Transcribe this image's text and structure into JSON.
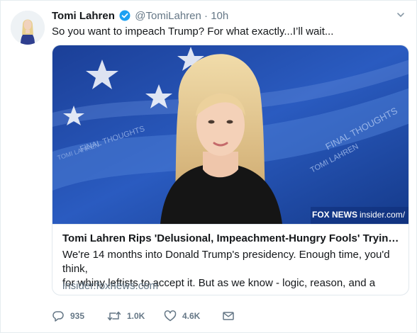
{
  "tweet": {
    "author_name": "Tomi Lahren",
    "handle": "@TomiLahren",
    "separator": "·",
    "time": "10h",
    "text": "So you want to impeach Trump? For what exactly...I’ll wait..."
  },
  "card": {
    "image": {
      "logo_brand": "FOX NEWS",
      "logo_suffix": "insider.com/",
      "banner_text": "FINAL THOUGHTS",
      "banner_name": "TOMI LAHREN"
    },
    "title": "Tomi Lahren Rips 'Delusional, Impeachment-Hungry Fools' Trying to T...",
    "description_line1": "We're 14 months into Donald Trump's presidency. Enough time, you'd think,",
    "description_line2": "for whiny leftists to accept it. But as we know - logic, reason, and a grasp",
    "domain": "insider.foxnews.com"
  },
  "actions": {
    "replies": "935",
    "retweets": "1.0K",
    "likes": "4.6K"
  },
  "colors": {
    "verified": "#1da1f2",
    "secondary_text": "#657786",
    "border": "#e1e8ed"
  }
}
